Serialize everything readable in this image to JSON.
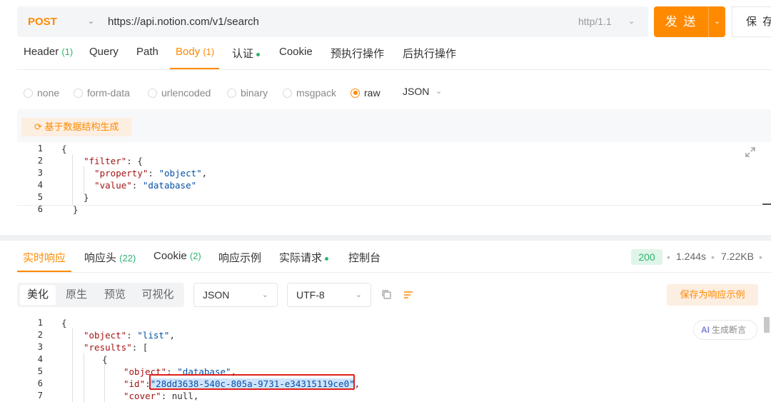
{
  "request": {
    "method": "POST",
    "url": "https://api.notion.com/v1/search",
    "http_version": "http/1.1",
    "send_label": "发 送",
    "save_label": "保 存"
  },
  "request_tabs": [
    {
      "label": "Header",
      "count": "(1)"
    },
    {
      "label": "Query",
      "count": ""
    },
    {
      "label": "Path",
      "count": ""
    },
    {
      "label": "Body",
      "count": "(1)",
      "active": true
    },
    {
      "label": "认证",
      "count": ""
    },
    {
      "label": "Cookie",
      "count": ""
    },
    {
      "label": "预执行操作",
      "count": ""
    },
    {
      "label": "后执行操作",
      "count": ""
    }
  ],
  "body_types": [
    "none",
    "form-data",
    "urlencoded",
    "binary",
    "msgpack",
    "raw"
  ],
  "body_type_selected": "raw",
  "body_format": "JSON",
  "generate_label": "基于数据结构生成",
  "request_body_lines": [
    {
      "no": "1",
      "text": "{"
    },
    {
      "no": "2",
      "text": "  \"filter\": {"
    },
    {
      "no": "3",
      "text": "    \"property\": \"object\","
    },
    {
      "no": "4",
      "text": "    \"value\": \"database\""
    },
    {
      "no": "5",
      "text": "  }"
    },
    {
      "no": "6",
      "text": "}"
    }
  ],
  "response_tabs": [
    {
      "label": "实时响应",
      "count": "",
      "active": true
    },
    {
      "label": "响应头",
      "count": "(22)"
    },
    {
      "label": "Cookie",
      "count": "(2)"
    },
    {
      "label": "响应示例",
      "count": ""
    },
    {
      "label": "实际请求",
      "count": ""
    },
    {
      "label": "控制台",
      "count": ""
    }
  ],
  "response_meta": {
    "status": "200",
    "time": "1.244s",
    "size": "7.22KB"
  },
  "view_modes": [
    "美化",
    "原生",
    "预览",
    "可视化"
  ],
  "view_mode_selected": "美化",
  "response_format": "JSON",
  "response_encoding": "UTF-8",
  "save_example_label": "保存为响应示例",
  "ai_label": "生成断言",
  "ai_badge": "AI",
  "response_lines": [
    {
      "no": "1"
    },
    {
      "no": "2"
    },
    {
      "no": "3"
    },
    {
      "no": "4"
    },
    {
      "no": "5"
    },
    {
      "no": "6"
    },
    {
      "no": "7"
    }
  ],
  "response_values": {
    "object_key": "\"object\"",
    "object_val": "\"list\"",
    "results_key": "\"results\"",
    "inner_object_key": "\"object\"",
    "inner_object_val": "\"database\"",
    "id_key": "\"id\"",
    "id_val": "\"28dd3638-540c-805a-9731-e34315119ce0\"",
    "cover_key": "\"cover\"",
    "cover_val": "null"
  }
}
